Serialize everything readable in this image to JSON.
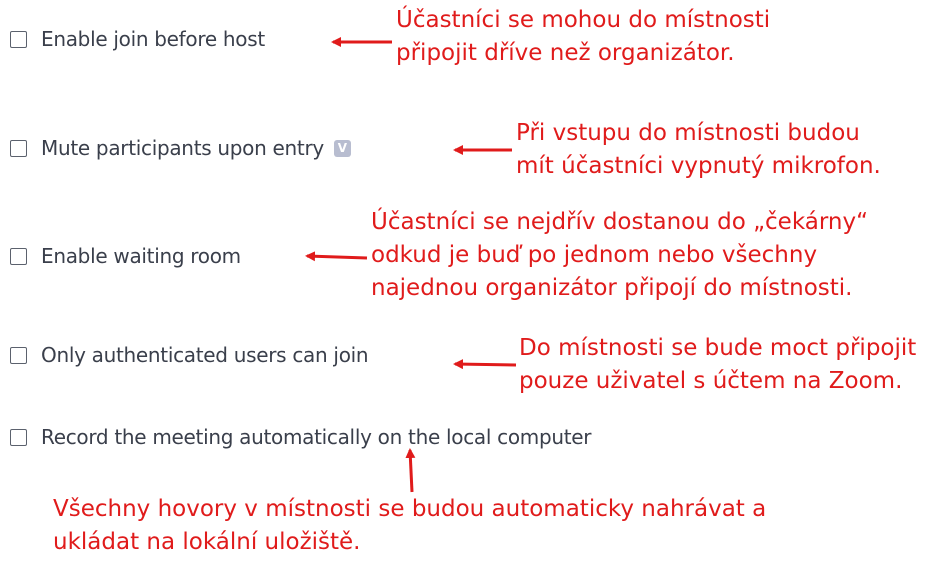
{
  "colors": {
    "annotation": "#e01b1b",
    "option_text": "#3a3f4b",
    "badge_bg": "#b8bdd0"
  },
  "options": [
    {
      "label": "Enable join before host",
      "checked": false
    },
    {
      "label": "Mute participants upon entry",
      "checked": false,
      "badge_icon": "v-badge-icon",
      "badge_text": "V"
    },
    {
      "label": "Enable waiting room",
      "checked": false
    },
    {
      "label": "Only authenticated users can join",
      "checked": false
    },
    {
      "label": "Record the meeting automatically on the local computer",
      "checked": false
    }
  ],
  "annotations": [
    "Účastníci se mohou do místnosti\npřipojit dříve než organizátor.",
    "Při vstupu do místnosti budou\nmít účastníci vypnutý mikrofon.",
    "Účastníci se nejdřív dostanou do „čekárny“\nodkud je buď po jednom nebo všechny\nnajednou organizátor připojí do místnosti.",
    "Do místnosti se bude moct připojit\npouze uživatel s účtem na Zoom.",
    "Všechny hovory v místnosti se budou automaticky nahrávat a\nukládat na lokální uložiště."
  ]
}
